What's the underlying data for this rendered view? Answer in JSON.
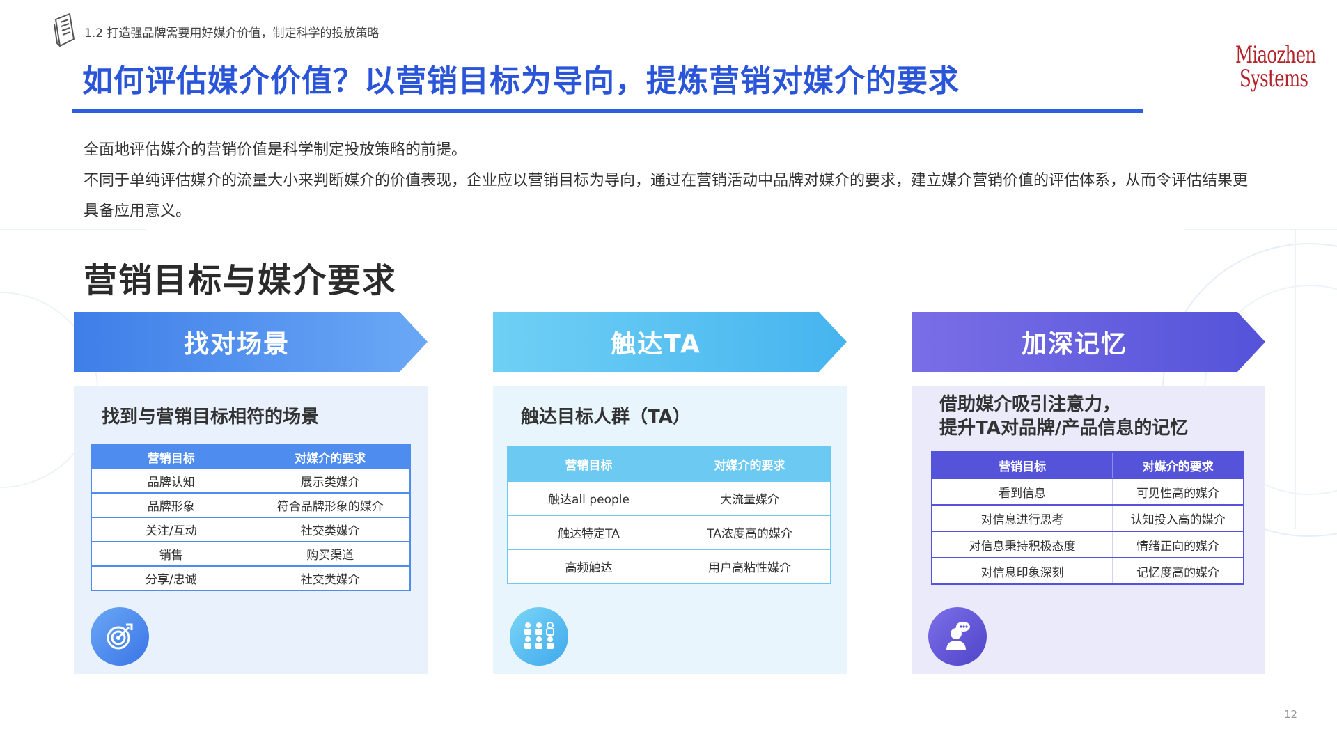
{
  "header": {
    "breadcrumb": "1.2 打造强品牌需要用好媒介价值，制定科学的投放策略",
    "title": "如何评估媒介价值？以营销目标为导向，提炼营销对媒介的要求"
  },
  "logo": {
    "line1": "Miaozhen",
    "line2": "Systems"
  },
  "intro": {
    "line1": "全面地评估媒介的营销价值是科学制定投放策略的前提。",
    "line2": "不同于单纯评估媒介的流量大小来判断媒介的价值表现，企业应以营销目标为导向，通过在营销活动中品牌对媒介的要求，建立媒介营销价值的评估体系，从而令评估结果更具备应用意义。"
  },
  "section_title": "营销目标与媒介要求",
  "columns": [
    {
      "header": "找对场景",
      "subtitle_1": "找到与营销目标相符的场景",
      "subtitle_2": "",
      "table_headers": [
        "营销目标",
        "对媒介的要求"
      ],
      "rows": [
        [
          "品牌认知",
          "展示类媒介"
        ],
        [
          "品牌形象",
          "符合品牌形象的媒介"
        ],
        [
          "关注/互动",
          "社交类媒介"
        ],
        [
          "销售",
          "购买渠道"
        ],
        [
          "分享/忠诚",
          "社交类媒介"
        ]
      ],
      "icon": "target-icon"
    },
    {
      "header": "触达TA",
      "subtitle_1": "触达目标人群（TA）",
      "subtitle_2": "",
      "table_headers": [
        "营销目标",
        "对媒介的要求"
      ],
      "rows": [
        [
          "触达all people",
          "大流量媒介"
        ],
        [
          "触达特定TA",
          "TA浓度高的媒介"
        ],
        [
          "高频触达",
          "用户高粘性媒介"
        ]
      ],
      "icon": "people-group-icon"
    },
    {
      "header": "加深记忆",
      "subtitle_1": "借助媒介吸引注意力，",
      "subtitle_2": "提升TA对品牌/产品信息的记忆",
      "table_headers": [
        "营销目标",
        "对媒介的要求"
      ],
      "rows": [
        [
          "看到信息",
          "可见性高的媒介"
        ],
        [
          "对信息进行思考",
          "认知投入高的媒介"
        ],
        [
          "对信息秉持积极态度",
          "情绪正向的媒介"
        ],
        [
          "对信息印象深刻",
          "记忆度高的媒介"
        ]
      ],
      "icon": "thinking-person-icon"
    }
  ],
  "colors": {
    "title_blue": "#2a55d8",
    "col1_arrow": "#4f8cf0",
    "col2_arrow": "#5ec4f2",
    "col3_arrow": "#5b5fdc",
    "col1_card": "#e9f1fd",
    "col2_card": "#e8f5fc",
    "col3_card": "#ebeafb",
    "logo_red": "#b3232a"
  },
  "page_number": "12"
}
